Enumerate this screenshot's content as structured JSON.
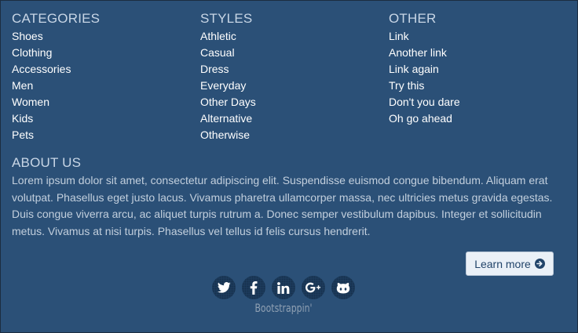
{
  "columns": [
    {
      "heading": "CATEGORIES",
      "links": [
        "Shoes",
        "Clothing",
        "Accessories",
        "Men",
        "Women",
        "Kids",
        "Pets"
      ]
    },
    {
      "heading": "STYLES",
      "links": [
        "Athletic",
        "Casual",
        "Dress",
        "Everyday",
        "Other Days",
        "Alternative",
        "Otherwise"
      ]
    },
    {
      "heading": "OTHER",
      "links": [
        "Link",
        "Another link",
        "Link again",
        "Try this",
        "Don't you dare",
        "Oh go ahead"
      ]
    }
  ],
  "about": {
    "heading": "ABOUT US",
    "text": "Lorem ipsum dolor sit amet, consectetur adipiscing elit. Suspendisse euismod congue bibendum. Aliquam erat volutpat. Phasellus eget justo lacus. Vivamus pharetra ullamcorper massa, nec ultricies metus gravida egestas. Duis congue viverra arcu, ac aliquet turpis rutrum a. Donec semper vestibulum dapibus. Integer et sollicitudin metus. Vivamus at nisi turpis. Phasellus vel tellus id felis cursus hendrerit."
  },
  "learn_more_label": "Learn more",
  "social_icons": [
    "twitter-icon",
    "facebook-icon",
    "linkedin-icon",
    "google-plus-icon",
    "github-icon"
  ],
  "brand": "Bootstrappin'",
  "colors": {
    "background": "#2b5077",
    "heading": "#c8d6e6",
    "link": "#ffffff",
    "button_bg": "#eaf0f7",
    "button_text": "#22446a"
  }
}
